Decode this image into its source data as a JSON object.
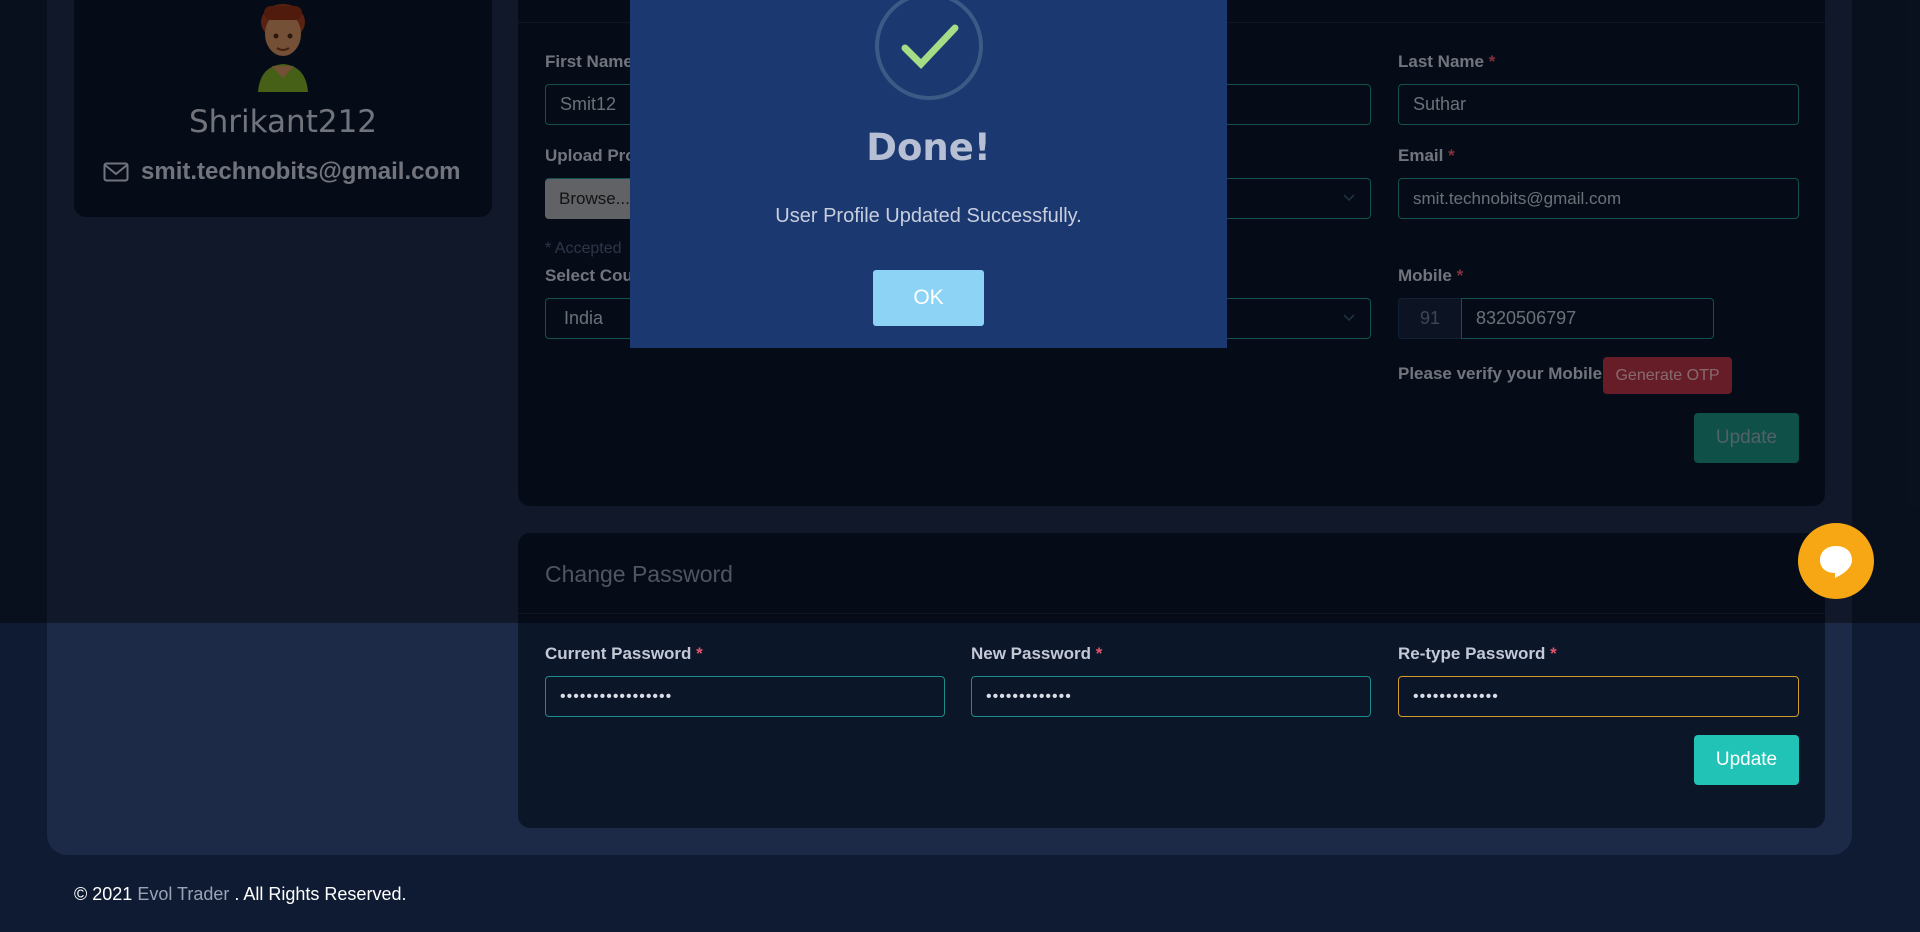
{
  "profile": {
    "username": "Shrikant212",
    "email": "smit.technobits@gmail.com"
  },
  "form": {
    "first_name_label": "First Name",
    "first_name_value": "Smit12",
    "last_name_label": "Last Name",
    "last_name_value": "Suthar",
    "upload_label": "Upload Pro",
    "browse_label": "Browse...",
    "email_label": "Email",
    "email_value": "smit.technobits@gmail.com",
    "accepted_note": "* Accepted",
    "country_label": "Select Cou",
    "country_value": "India",
    "mobile_label": "Mobile",
    "mobile_code": "91",
    "mobile_value": "8320506797",
    "verify_text": "Please verify your Mobile",
    "otp_button": "Generate OTP",
    "update_button": "Update",
    "required_mark": "*"
  },
  "password": {
    "title": "Change Password",
    "current_label": "Current Password",
    "current_value": "•••••••••••••••••",
    "new_label": "New Password",
    "new_value": "•••••••••••••",
    "retype_label": "Re-type Password",
    "retype_value": "•••••••••••••",
    "update_button": "Update"
  },
  "modal": {
    "title": "Done!",
    "message": "User Profile Updated Successfully.",
    "ok_button": "OK"
  },
  "footer": {
    "prefix": "© 2021",
    "brand": "Evol Trader",
    "suffix": ". All Rights Reserved."
  },
  "colors": {
    "accent": "#20c3b6",
    "otp": "#b23344",
    "chat": "#f7a713",
    "modal_bg": "#1c3870",
    "ok_button": "#8cd3f5",
    "check": "#a5dc86"
  },
  "icons": {
    "avatar": "user-avatar",
    "email": "envelope-icon",
    "success": "checkmark-icon",
    "chat": "chat-bubble-icon",
    "select": "chevron-down-icon"
  }
}
